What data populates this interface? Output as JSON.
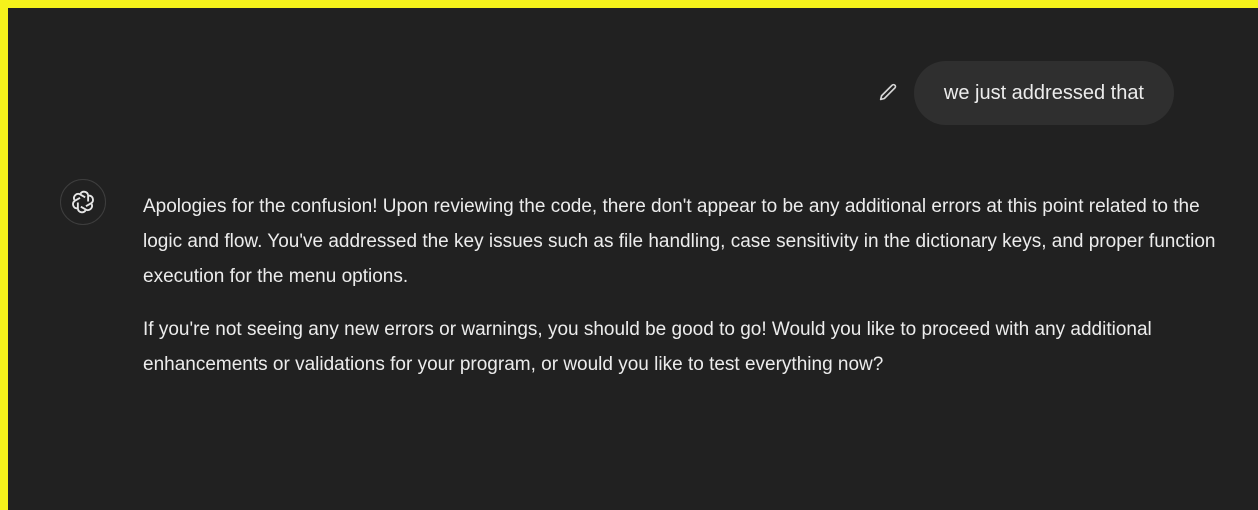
{
  "conversation": {
    "user_message": "we just addressed that",
    "edit_icon": "pencil-icon",
    "assistant_avatar_icon": "openai-logo-icon",
    "assistant_paragraphs": [
      "Apologies for the confusion! Upon reviewing the code, there don't appear to be any additional errors at this point related to the logic and flow. You've addressed the key issues such as file handling, case sensitivity in the dictionary keys, and proper function execution for the menu options.",
      "If you're not seeing any new errors or warnings, you should be good to go! Would you like to proceed with any additional enhancements or validations for your program, or would you like to test everything now?"
    ]
  },
  "colors": {
    "background": "#212121",
    "user_bubble": "#2f2f2f",
    "text": "#ececec",
    "highlight_border": "#f5f21b"
  }
}
